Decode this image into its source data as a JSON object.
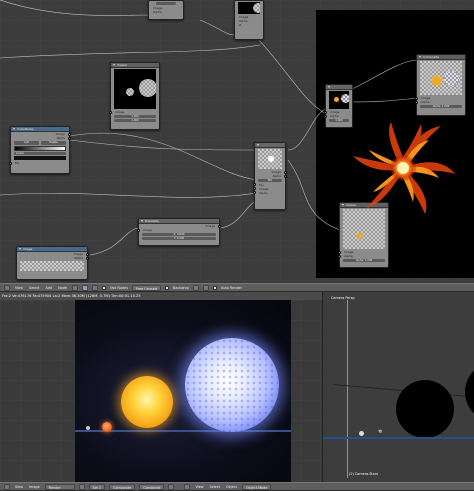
{
  "node_editor": {
    "nodes": {
      "top_a": {
        "title": "",
        "rows": [
          "",
          "Image",
          "Alpha"
        ]
      },
      "top_b": {
        "title": "",
        "rows": [
          "Image",
          "Alpha",
          "Z"
        ]
      },
      "viewer": {
        "title": "Viewer",
        "rows": [
          "Image",
          "Alpha",
          "Z"
        ],
        "field1": "1.000",
        "field2": "1.000"
      },
      "colorramp": {
        "title": "ColorRamp",
        "rows": [
          "Image",
          "Alpha"
        ],
        "add": "Add",
        "delete": "Delete",
        "mode": "Linear",
        "fac": "Fac"
      },
      "composite": {
        "title": "Composite",
        "rows": [
          "Image",
          "Alpha",
          "Z"
        ],
        "alpha": "Alpha: 1.000"
      },
      "small_node": {
        "title": "",
        "rows": [
          "Image",
          "Alpha"
        ],
        "field": "1.000"
      },
      "mix": {
        "title": "",
        "rows": [
          "Image",
          "Alpha",
          "Image",
          "Alpha"
        ],
        "field": "Mix",
        "fac": "Fac"
      },
      "viewer2": {
        "title": "Viewer",
        "rows": [
          "Image",
          "Alpha",
          "Z"
        ],
        "alpha": "Alpha: 1.000"
      },
      "translate": {
        "title": "Translate",
        "rows": [
          "Image",
          "Image"
        ],
        "x": "X: 0.000",
        "y": "Y: 0.000"
      },
      "image": {
        "title": "Image",
        "rows": [
          "Image",
          "Alpha",
          "Z"
        ]
      }
    }
  },
  "node_header": {
    "view": "View",
    "select": "Select",
    "add": "Add",
    "node": "Node",
    "use_nodes": "Use Nodes",
    "free_unused": "Free Unused",
    "backdrop": "Backdrop",
    "auto_render": "Auto Render"
  },
  "info_line": "Fra:2 Ve:476176 Fa:475904 La:2 Mem:36.30M (126M, 0.7M) Tim:00:01.15.25",
  "render": {
    "camera_label": "Camera Persp",
    "camera_name": "(2) Camera.Stars"
  },
  "bottom_bar": {
    "view": "View",
    "image": "Image",
    "render_result": "Render Result",
    "layer": "Sel 1",
    "composite": "Composite",
    "combined": "Combined",
    "view2": "View",
    "select": "Select",
    "object": "Object",
    "mode": "Object Mode"
  },
  "colors": {
    "viewer_bg": "#000000",
    "node_body": "#8b8b8b",
    "header_bg": "#5e5e5e",
    "blue_star": "#b7c1ff",
    "yellow_star": "#ffd23a",
    "fire": "#ff7a1a"
  }
}
